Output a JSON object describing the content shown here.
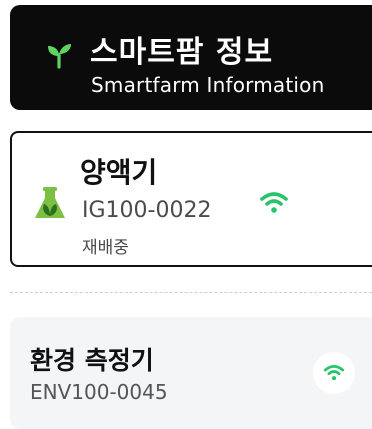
{
  "header": {
    "title": "스마트팜 정보",
    "subtitle": "Smartfarm Information",
    "icon": "sprout-icon"
  },
  "devices": [
    {
      "name": "양액기",
      "code": "IG100-0022",
      "status": "재배중",
      "icon": "flask-icon",
      "connection_icon": "wifi-icon",
      "selected": true
    },
    {
      "name": "환경 측정기",
      "code": "ENV100-0045",
      "connection_icon": "wifi-icon",
      "selected": false
    }
  ],
  "colors": {
    "header_bg": "#0b0b0b",
    "accent_green": "#27c46a",
    "flask_green": "#7cc043",
    "card_bg": "#f4f5f7"
  }
}
